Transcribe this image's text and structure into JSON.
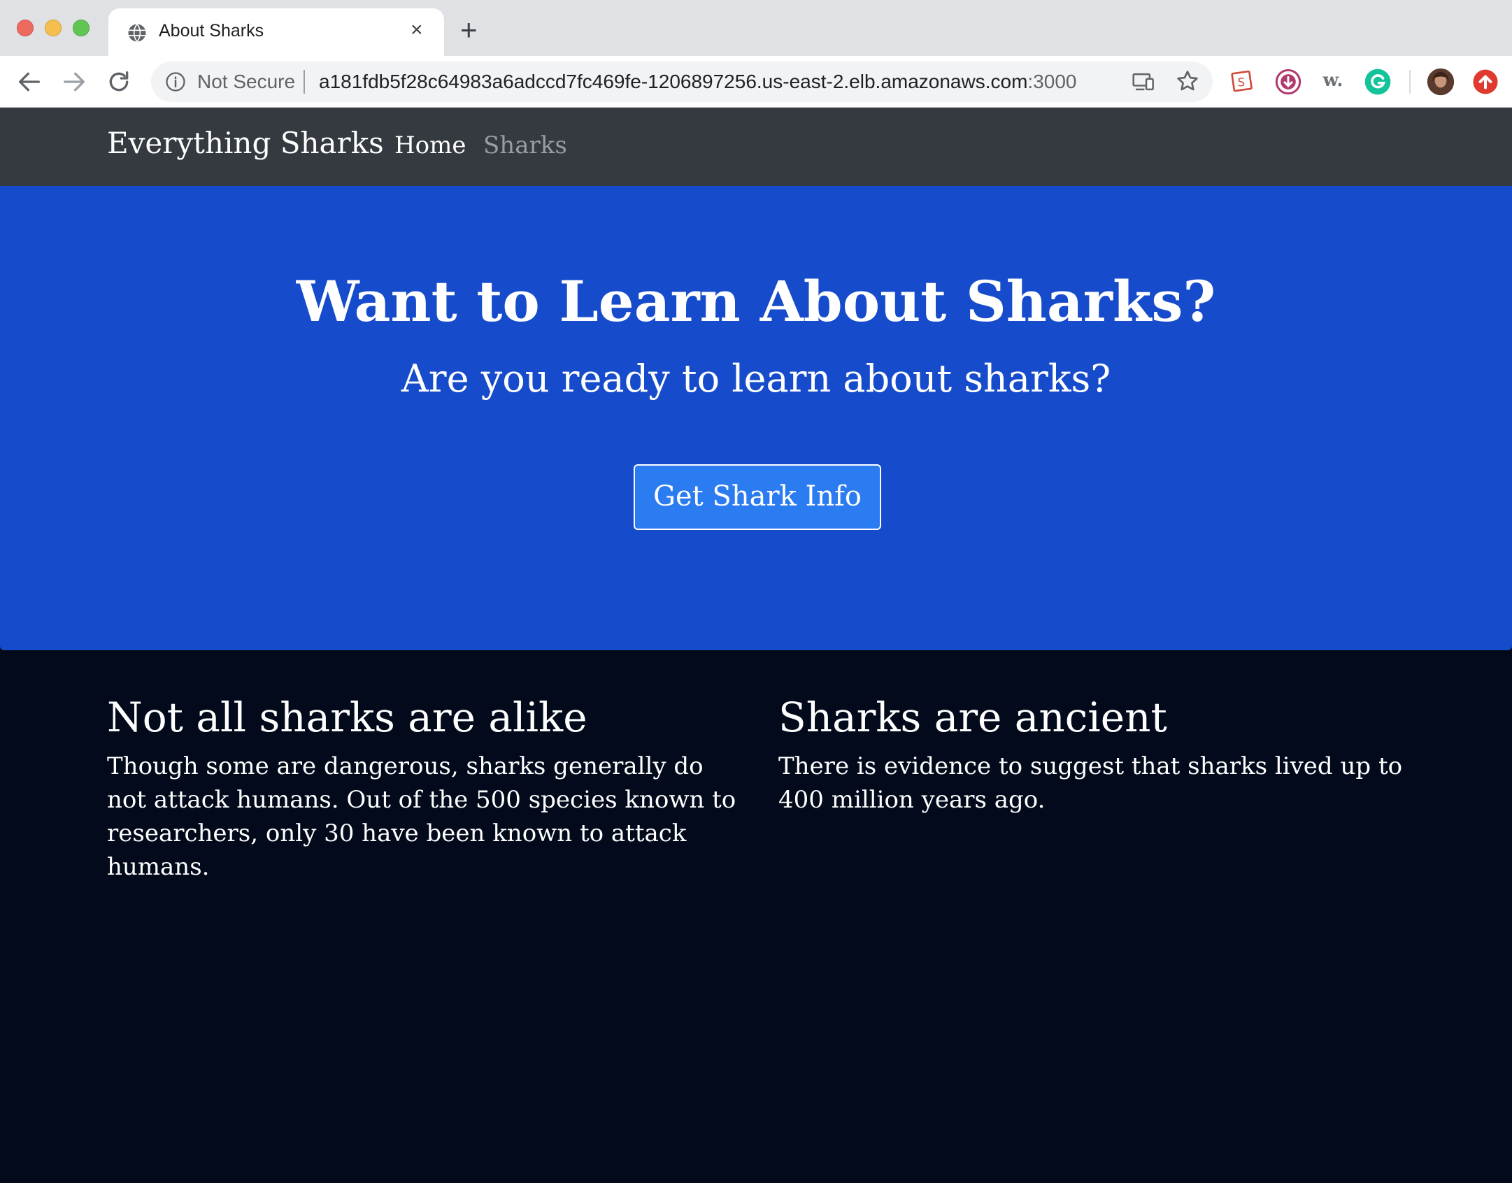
{
  "browser": {
    "tab": {
      "title": "About Sharks",
      "favicon": "globe-icon",
      "close": "×"
    },
    "new_tab": "+",
    "nav_icons": [
      "back-arrow-icon",
      "forward-arrow-icon",
      "reload-icon"
    ],
    "omnibox": {
      "security_label": "Not Secure",
      "url_host": "a181fdb5f28c64983a6adccd7fc469fe-1206897256.us-east-2.elb.amazonaws.com",
      "url_port": ":3000"
    },
    "extensions": [
      "slides-extension-icon",
      "download-extension-icon",
      "w-extension-icon",
      "grammarly-icon",
      "profile-avatar",
      "update-icon"
    ],
    "extension_w_label": "w."
  },
  "site": {
    "brand": "Everything Sharks",
    "nav": {
      "home": "Home",
      "sharks": "Sharks"
    }
  },
  "hero": {
    "title": "Want to Learn About Sharks?",
    "lead": "Are you ready to learn about sharks?",
    "button": "Get Shark Info",
    "background_color": "#164ccb",
    "button_color": "#2b7bf1"
  },
  "content": {
    "left": {
      "heading": "Not all sharks are alike",
      "text": "Though some are dangerous, sharks generally do not attack humans. Out of the 500 species known to researchers, only 30 have been known to attack humans."
    },
    "right": {
      "heading": "Sharks are ancient",
      "text": "There is evidence to suggest that sharks lived up to 400 million years ago."
    }
  }
}
